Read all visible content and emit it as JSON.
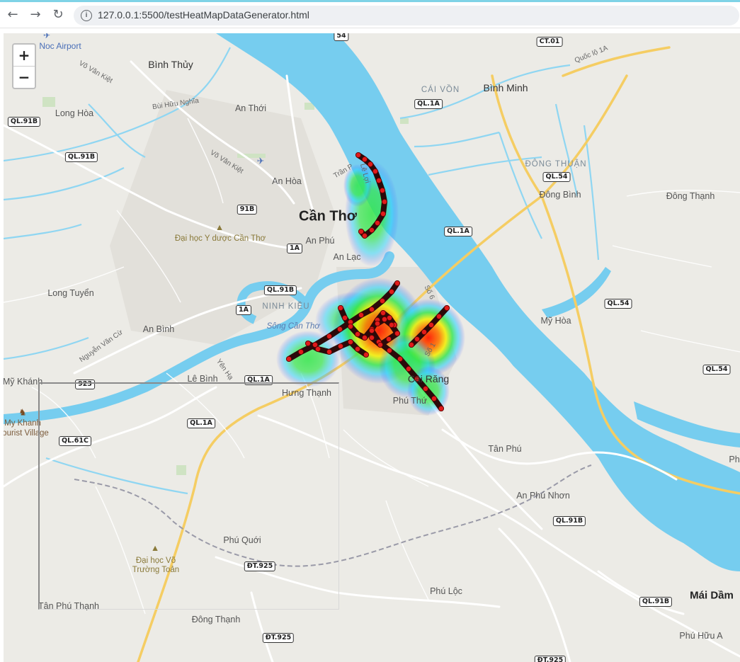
{
  "browser": {
    "url": "127.0.0.1:5500/testHeatMapDataGenerator.html",
    "back_icon": "arrow-left-icon",
    "forward_icon": "arrow-right-icon",
    "reload_icon": "reload-icon",
    "info_icon": "info-icon"
  },
  "zoom": {
    "in_label": "+",
    "out_label": "−"
  },
  "colors": {
    "land": "#ecebe6",
    "river": "#76cdef",
    "highway": "#f5cd63",
    "road": "#ffffff",
    "track_point": "#e01b1b",
    "track_line": "#2b0a0a"
  },
  "heatmap_legend_gradient": [
    "#4a4dff",
    "#22d3ff",
    "#31e64a",
    "#f5f000",
    "#ff7a00",
    "#ff1a00"
  ],
  "places": {
    "noc_airport": "Noc Airport",
    "binh_thuy": "Bình Thủy",
    "vo_van_kiet_1": "Võ Văn Kiệt",
    "bui_huu_nghia": "Bùi Hữu Nghĩa",
    "long_hoa": "Long Hòa",
    "an_thoi": "An Thới",
    "vo_van_kiet_2": "Võ Văn Kiệt",
    "an_hoa": "An Hòa",
    "can_tho": "Cần Thơ",
    "dai_hoc_y_duoc": "Đại học Y dược Cần Thơ",
    "an_phu": "An Phú",
    "an_lac": "An Lạc",
    "long_tuyen": "Long Tuyển",
    "ninh_kieu": "NINH KIỀU",
    "song_can_tho": "Sông Cần Thơ",
    "an_binh": "An Bình",
    "nguyen_van_cu": "Nguyễn Văn Cừ",
    "le_binh": "Lê Bình",
    "yen_ha": "Yên Hạ",
    "hung_thanh": "Hưng Thạnh",
    "my_khanh": "Mỹ Khánh",
    "my_khanh_village": "My Khanh",
    "tourist_village": "ourist Village",
    "cai_rang": "Cái Răng",
    "phu_thu": "Phú Thứ",
    "tan_phu": "Tân Phú",
    "an_phu_nhon": "An Phú Nhơn",
    "phu_quoi": "Phú Quới",
    "dai_hoc_vo_truong_toan": "Đại học Võ\nTrường Toản",
    "phu_loc": "Phú Lộc",
    "tan_phu_thanh": "Tân Phú Thạnh",
    "dong_thanh_s": "Đông Thạnh",
    "mai_dam": "Mái Dầm",
    "phu_huu_a": "Phú Hữu A",
    "phu_edge": "Ph",
    "cai_von": "CÁI VỒN",
    "binh_minh": "Bình Minh",
    "dong_thuan": "ĐÔNG THUẬN",
    "dong_binh": "Đông Bình",
    "dong_thanh_n": "Đông Thạnh",
    "my_hoa": "Mỹ Hòa",
    "tran_phu": "Trần P",
    "le_loi": "Lê Lợi",
    "so_6": "Số 6",
    "so_1": "Số 1",
    "quoc_lo_1a": "Quốc lộ 1A"
  },
  "shields": {
    "s54": "54",
    "ct01": "CT.01",
    "ql1a_a": "QL.1A",
    "ql91b_a": "QL.91B",
    "ql91b_b": "QL.91B",
    "ql54_a": "QL.54",
    "s91b": "91B",
    "s1a_a": "1A",
    "ql1a_b": "QL.1A",
    "ql91b_c": "QL.91B",
    "s1a_b": "1A",
    "ql54_b": "QL.54",
    "ql1a_c": "QL.1A",
    "s923": "923",
    "ql1a_d": "QL.1A",
    "ql61c": "QL.61C",
    "ql54_c": "QL.54",
    "ql91b_d": "QL.91B",
    "dt925_a": "ĐT.925",
    "dt925_b": "ĐT.925",
    "ql91b_e": "QL.91B",
    "dt925_c": "ĐT.925"
  }
}
